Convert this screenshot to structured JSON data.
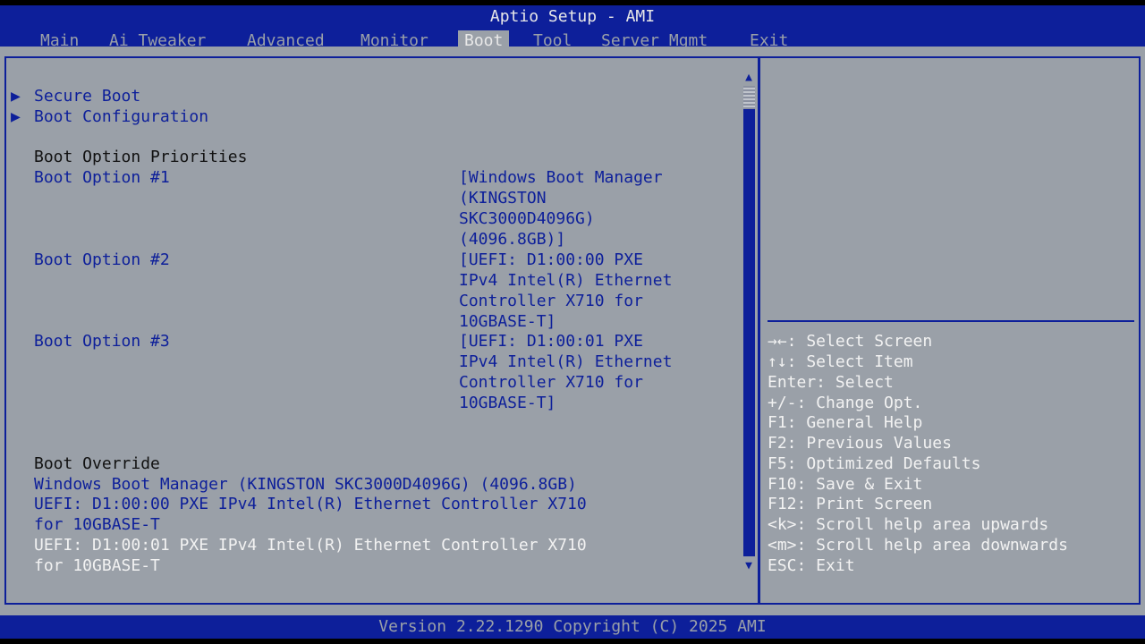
{
  "header": {
    "title": "Aptio Setup - AMI",
    "tabs": [
      "Main",
      "Ai Tweaker",
      "Advanced",
      "Monitor",
      "Boot",
      "Tool",
      "Server Mgmt",
      "Exit"
    ],
    "active_tab": "Boot"
  },
  "boot": {
    "secure_boot": "Secure Boot",
    "boot_configuration": "Boot Configuration",
    "priorities_heading": "Boot Option Priorities",
    "options": [
      {
        "label": "Boot Option #1",
        "value_lines": [
          "[Windows Boot Manager",
          "(KINGSTON",
          "SKC3000D4096G)",
          "(4096.8GB)]"
        ]
      },
      {
        "label": "Boot Option #2",
        "value_lines": [
          "[UEFI: D1:00:00 PXE",
          "IPv4 Intel(R) Ethernet",
          "Controller X710 for",
          "10GBASE-T]"
        ]
      },
      {
        "label": "Boot Option #3",
        "value_lines": [
          "[UEFI: D1:00:01 PXE",
          "IPv4 Intel(R) Ethernet",
          "Controller X710 for",
          "10GBASE-T]"
        ]
      }
    ],
    "override_heading": "Boot Override",
    "overrides": [
      {
        "lines": [
          "Windows Boot Manager (KINGSTON SKC3000D4096G) (4096.8GB)"
        ]
      },
      {
        "lines": [
          "UEFI: D1:00:00 PXE IPv4 Intel(R) Ethernet Controller X710",
          "for 10GBASE-T"
        ]
      },
      {
        "lines": [
          "UEFI: D1:00:01 PXE IPv4 Intel(R) Ethernet Controller X710",
          "for 10GBASE-T"
        ]
      }
    ],
    "selected_override": 2
  },
  "help": {
    "keys": [
      "→←: Select Screen",
      "↑↓: Select Item",
      "Enter: Select",
      "+/-: Change Opt.",
      "F1: General Help",
      "F2: Previous Values",
      "F5: Optimized Defaults",
      "F10: Save & Exit",
      "F12: Print Screen",
      "<k>: Scroll help area upwards",
      "<m>: Scroll help area downwards",
      "ESC: Exit"
    ]
  },
  "footer": {
    "version": "Version 2.22.1290 Copyright (C) 2025 AMI"
  },
  "colors": {
    "bar": "#0d1f9a",
    "panel": "#9aa0a8",
    "selected_text": "#f2f2f2"
  }
}
